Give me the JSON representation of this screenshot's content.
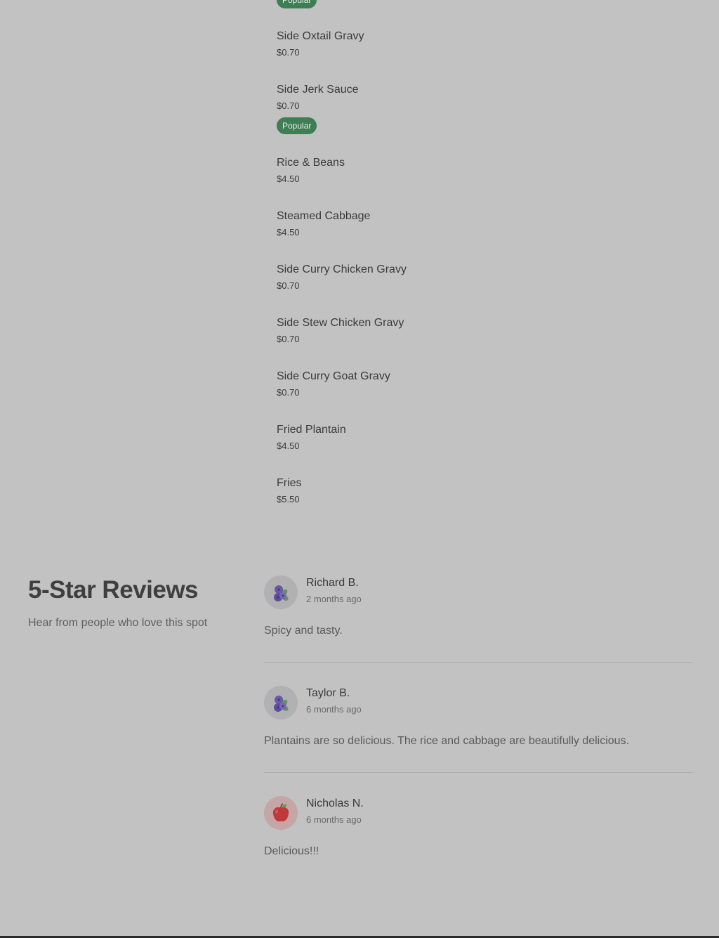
{
  "menu": {
    "badge_label": "Popular",
    "items": [
      {
        "name": "Side Oxtail Gravy",
        "price": "$0.70"
      },
      {
        "name": "Side Jerk Sauce",
        "price": "$0.70"
      },
      {
        "name": "Rice & Beans",
        "price": "$4.50"
      },
      {
        "name": "Steamed Cabbage",
        "price": "$4.50"
      },
      {
        "name": "Side Curry Chicken Gravy",
        "price": "$0.70"
      },
      {
        "name": "Side Stew Chicken Gravy",
        "price": "$0.70"
      },
      {
        "name": "Side Curry Goat Gravy",
        "price": "$0.70"
      },
      {
        "name": "Fried Plantain",
        "price": "$4.50"
      },
      {
        "name": "Fries",
        "price": "$5.50"
      }
    ]
  },
  "reviews": {
    "title": "5-Star Reviews",
    "subtitle": "Hear from people who love this spot",
    "list": [
      {
        "name": "Richard B.",
        "time": "2 months ago",
        "text": "Spicy and tasty.",
        "avatar": "blueberry-icon"
      },
      {
        "name": "Taylor B.",
        "time": "6 months ago",
        "text": "Plantains are so delicious. The rice and cabbage are beautifully delicious.",
        "avatar": "blueberry-icon"
      },
      {
        "name": "Nicholas N.",
        "time": "6 months ago",
        "text": "Delicious!!!",
        "avatar": "apple-icon"
      }
    ]
  },
  "colors": {
    "background": "#c2c2c2",
    "badge": "#3f7d55"
  }
}
